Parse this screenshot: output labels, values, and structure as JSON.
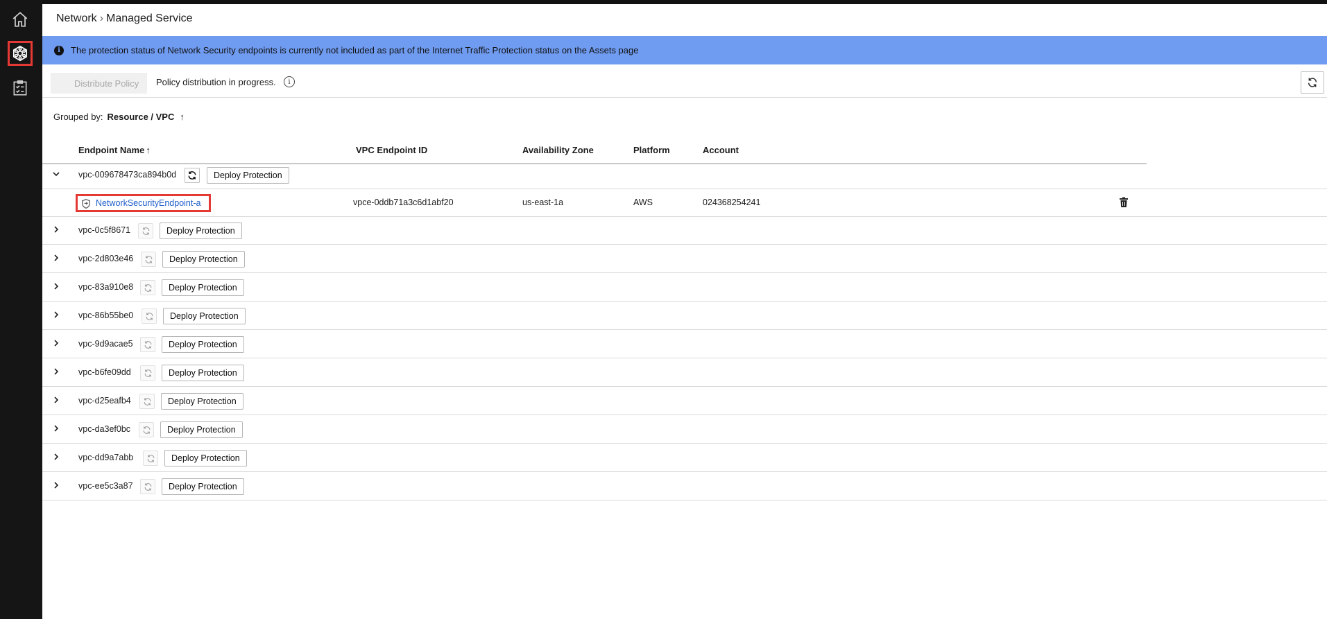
{
  "breadcrumb": {
    "parent": "Network",
    "separator": "›",
    "current": "Managed Service"
  },
  "banner": {
    "text": "The protection status of Network Security endpoints is currently not included as part of the Internet Traffic Protection status on the Assets page"
  },
  "toolbar": {
    "distribute_label": "Distribute Policy",
    "status_text": "Policy distribution in progress."
  },
  "grouping": {
    "label": "Grouped by:",
    "value": "Resource / VPC"
  },
  "table": {
    "headers": {
      "endpoint_name": "Endpoint Name",
      "vpc_endpoint_id": "VPC Endpoint ID",
      "availability_zone": "Availability Zone",
      "platform": "Platform",
      "account": "Account"
    },
    "deploy_label": "Deploy Protection",
    "groups": [
      {
        "vpc": "vpc-009678473ca894b0d",
        "expanded": true
      },
      {
        "vpc": "vpc-0c5f8671"
      },
      {
        "vpc": "vpc-2d803e46"
      },
      {
        "vpc": "vpc-83a910e8"
      },
      {
        "vpc": "vpc-86b55be0"
      },
      {
        "vpc": "vpc-9d9acae5"
      },
      {
        "vpc": "vpc-b6fe09dd"
      },
      {
        "vpc": "vpc-d25eafb4"
      },
      {
        "vpc": "vpc-da3ef0bc"
      },
      {
        "vpc": "vpc-dd9a7abb"
      },
      {
        "vpc": "vpc-ee5c3a87"
      }
    ],
    "endpoint": {
      "name": "NetworkSecurityEndpoint-a",
      "vpc_endpoint_id": "vpce-0ddb71a3c6d1abf20",
      "availability_zone": "us-east-1a",
      "platform": "AWS",
      "account": "024368254241"
    }
  },
  "icons": [
    "home-icon",
    "network-icon",
    "checklist-icon",
    "info-icon",
    "refresh-icon",
    "chevron-down-icon",
    "chevron-right-icon",
    "shield-icon",
    "trash-icon",
    "sort-up-icon"
  ],
  "colors": {
    "banner": "#6f9bf0",
    "link": "#1f5fc9",
    "highlight": "#e53935"
  }
}
